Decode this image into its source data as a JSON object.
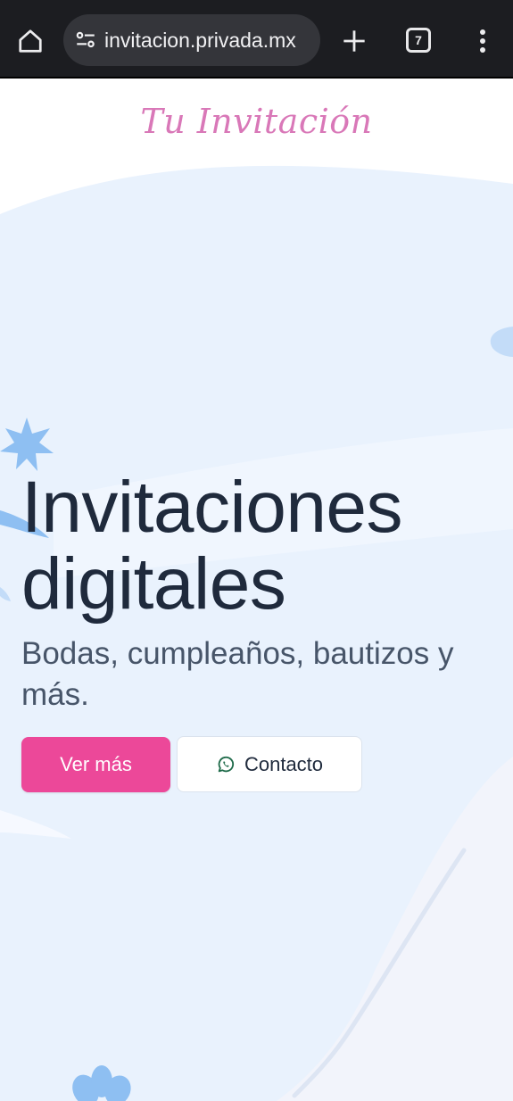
{
  "browser": {
    "url": "invitacion.privada.mx",
    "tab_count": "7",
    "icons": {
      "home": "home-icon",
      "site_settings": "site-settings-icon",
      "new_tab": "plus-icon",
      "tabs": "tabs-icon",
      "menu": "more-vert-icon"
    }
  },
  "header": {
    "logo_text": "Tu Invitación"
  },
  "hero": {
    "title_line1": "Invitaciones",
    "title_line2": "digitales",
    "subtitle": "Bodas, cumpleaños, bautizos y más.",
    "primary_button": "Ver más",
    "secondary_button": "Contacto",
    "secondary_icon": "whatsapp-icon"
  },
  "colors": {
    "chrome_bg": "#1c1d21",
    "logo": "#d978b8",
    "primary_button": "#ec4899",
    "background": "#e8f1fc",
    "flower": "#8ebff2",
    "heading": "#1f2a3c"
  }
}
